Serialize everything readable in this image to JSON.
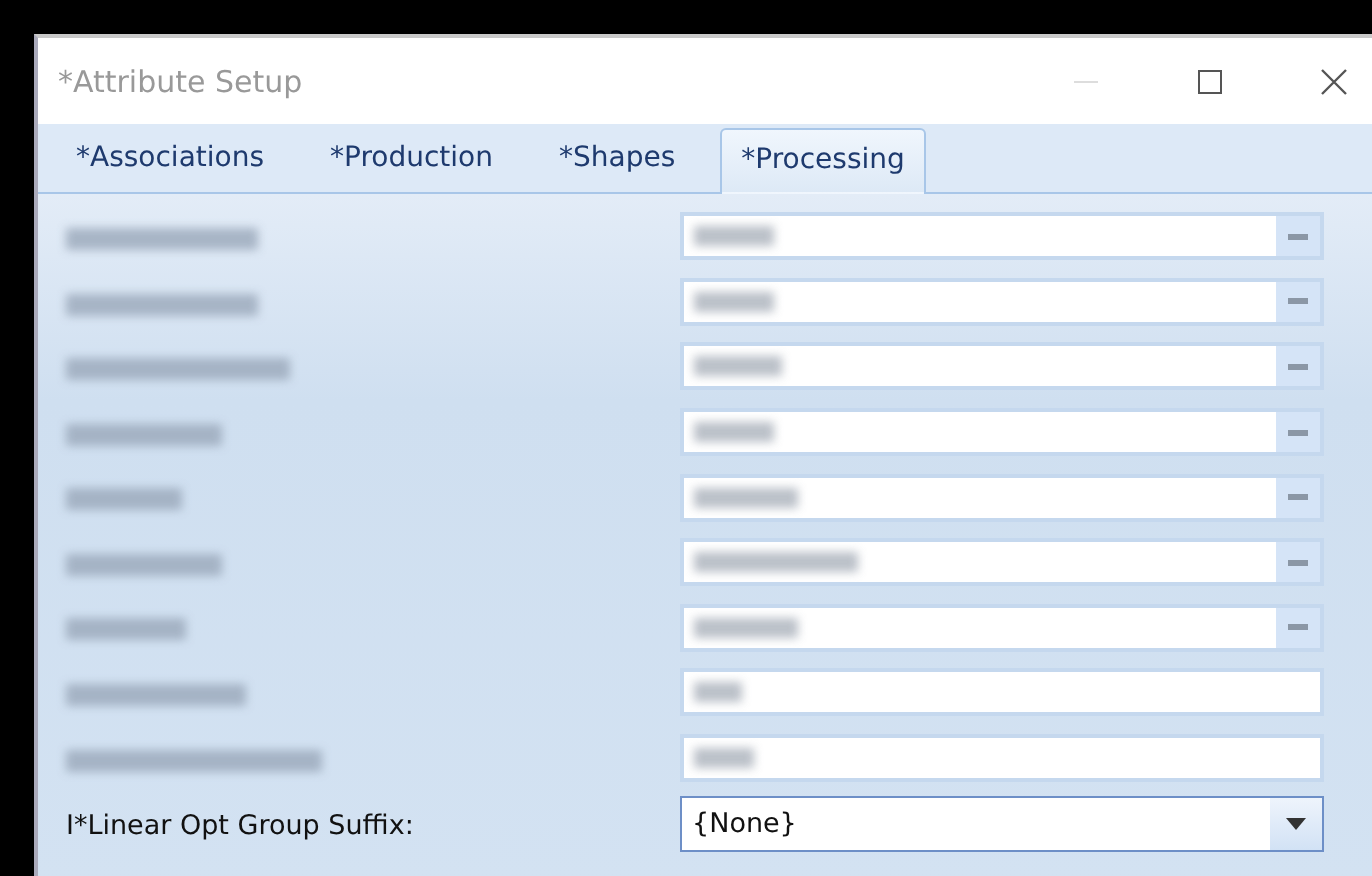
{
  "window": {
    "title": "*Attribute Setup"
  },
  "tabs": [
    {
      "label": "*Associations",
      "selected": false
    },
    {
      "label": "*Production",
      "selected": false
    },
    {
      "label": "*Shapes",
      "selected": false
    },
    {
      "label": "*Processing",
      "selected": true
    }
  ],
  "rows": [
    {
      "kind": "redacted-dropdown"
    },
    {
      "kind": "redacted-dropdown"
    },
    {
      "kind": "redacted-dropdown"
    },
    {
      "kind": "redacted-dropdown"
    },
    {
      "kind": "redacted-dropdown"
    },
    {
      "kind": "redacted-dropdown"
    },
    {
      "kind": "redacted-dropdown"
    },
    {
      "kind": "redacted-text"
    },
    {
      "kind": "redacted-text"
    },
    {
      "kind": "dropdown",
      "label": "I*Linear Opt Group Suffix:",
      "value": "{None}"
    }
  ]
}
